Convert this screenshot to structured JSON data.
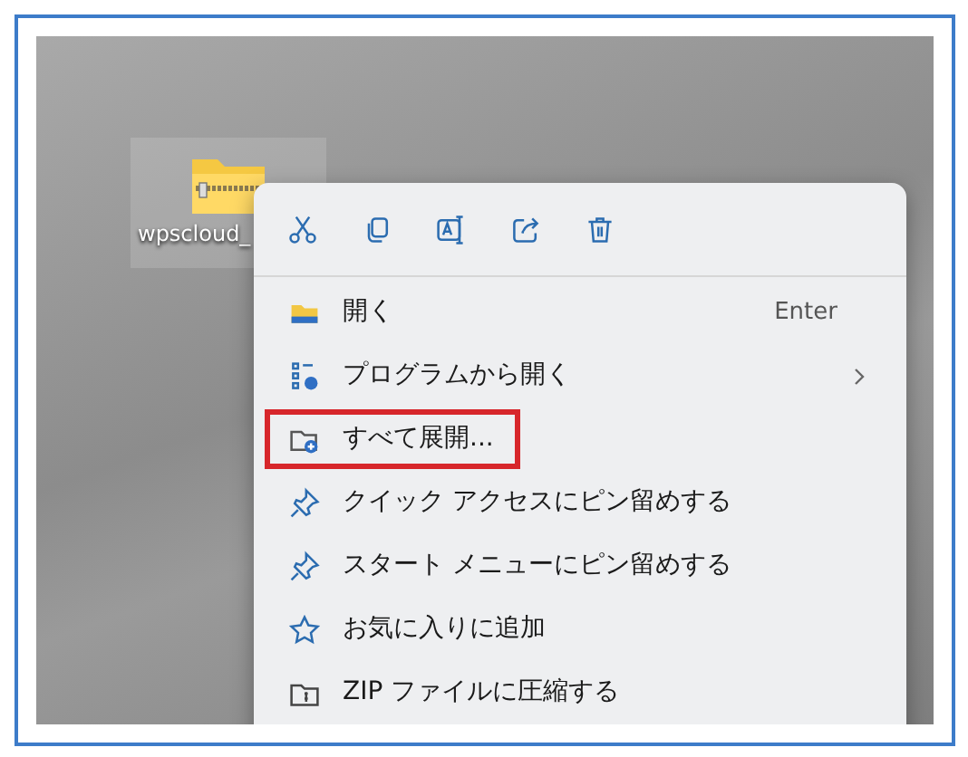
{
  "desktop_icon": {
    "label": "wpscloud_"
  },
  "context_menu": {
    "toolbar": [
      {
        "kind": "cut"
      },
      {
        "kind": "copy"
      },
      {
        "kind": "rename"
      },
      {
        "kind": "share"
      },
      {
        "kind": "delete"
      }
    ],
    "items": [
      {
        "kind": "open",
        "label": "開く",
        "shortcut": "Enter",
        "submenu": false,
        "highlighted": false
      },
      {
        "kind": "open-with",
        "label": "プログラムから開く",
        "submenu": true,
        "highlighted": false
      },
      {
        "kind": "extract",
        "label": "すべて展開...",
        "submenu": false,
        "highlighted": true
      },
      {
        "kind": "pin",
        "label": "クイック アクセスにピン留めする",
        "submenu": false,
        "highlighted": false
      },
      {
        "kind": "pin",
        "label": "スタート メニューにピン留めする",
        "submenu": false,
        "highlighted": false
      },
      {
        "kind": "favorite",
        "label": "お気に入りに追加",
        "submenu": false,
        "highlighted": false
      },
      {
        "kind": "zip",
        "label": "ZIP ファイルに圧縮する",
        "submenu": false,
        "highlighted": false
      }
    ]
  }
}
